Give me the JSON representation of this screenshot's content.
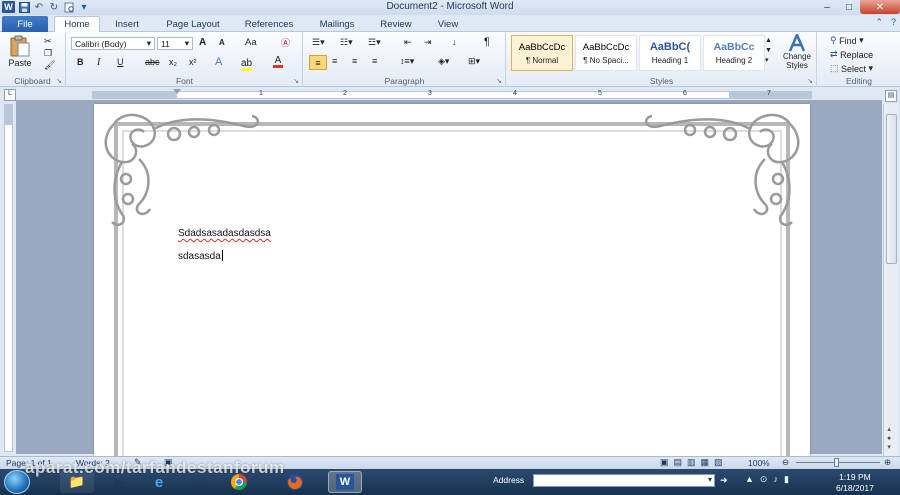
{
  "window": {
    "title": "Document2 - Microsoft Word",
    "minimize_glyph": "–",
    "maximize_glyph": "□",
    "close_glyph": "✕"
  },
  "qat": {
    "app_icon_letter": "W",
    "icons": [
      "save-icon",
      "undo-icon",
      "redo-icon",
      "print-preview-icon",
      "customize-icon"
    ]
  },
  "tabs": [
    {
      "label": "File"
    },
    {
      "label": "Home"
    },
    {
      "label": "Insert"
    },
    {
      "label": "Page Layout"
    },
    {
      "label": "References"
    },
    {
      "label": "Mailings"
    },
    {
      "label": "Review"
    },
    {
      "label": "View"
    }
  ],
  "ribbon": {
    "clipboard": {
      "paste_label": "Paste",
      "group_label": "Clipboard"
    },
    "font": {
      "family": "Calibri (Body)",
      "size": "11",
      "bold": "B",
      "italic": "I",
      "underline": "U",
      "strike": "abc",
      "subscript": "x₂",
      "superscript": "x²",
      "grow": "A",
      "shrink": "A",
      "case": "Aa",
      "group_label": "Font"
    },
    "paragraph": {
      "pilcrow": "¶",
      "group_label": "Paragraph"
    },
    "styles": {
      "items": [
        {
          "preview": "AaBbCcDc",
          "name": "¶ Normal"
        },
        {
          "preview": "AaBbCcDc",
          "name": "¶ No Spaci..."
        },
        {
          "preview": "AaBbC(",
          "name": "Heading 1"
        },
        {
          "preview": "AaBbCc",
          "name": "Heading 2"
        }
      ],
      "change_styles_label": "Change Styles",
      "group_label": "Styles"
    },
    "editing": {
      "find_label": "Find",
      "replace_label": "Replace",
      "select_label": "Select",
      "group_label": "Editing"
    }
  },
  "ruler": {
    "marks": [
      "1",
      "2",
      "3",
      "4",
      "5",
      "6",
      "7"
    ]
  },
  "document": {
    "line1": "Sdadsasadasdasdsa",
    "line2": "sdasasda"
  },
  "status": {
    "page": "Page: 1 of 1",
    "words": "Words: 2",
    "zoom": "100%"
  },
  "taskbar": {
    "address_label": "Address",
    "time": "1:19 PM",
    "date": "6/18/2017"
  },
  "watermark": "aparat.com/tarfandestanforum",
  "colors": {
    "file_tab": "#2a5fad",
    "ribbon_bg": "#e3ebf6",
    "spelling_underline": "#e0302a",
    "taskbar": "#17324f"
  }
}
